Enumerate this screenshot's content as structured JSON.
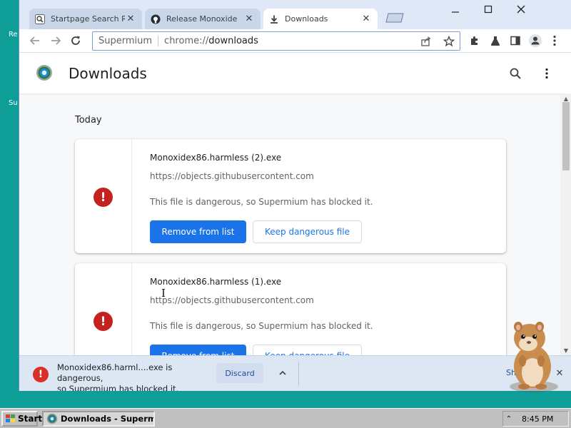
{
  "desktop": {
    "labels": [
      "Re",
      "Su"
    ]
  },
  "window": {
    "tabs": [
      {
        "title": "Startpage Search Results",
        "icon": "startpage-search-icon",
        "state": "inactive"
      },
      {
        "title": "Release Monoxide",
        "icon": "github-icon",
        "state": "inactive"
      },
      {
        "title": "Downloads",
        "icon": "download-icon",
        "state": "active"
      }
    ],
    "controls": [
      "minimize",
      "maximize",
      "close"
    ]
  },
  "toolbar": {
    "omnibox_origin": "Supermium",
    "omnibox_scheme": "chrome://",
    "omnibox_path": "downloads"
  },
  "page": {
    "title": "Downloads",
    "section": "Today",
    "items": [
      {
        "filename": "Monoxidex86.harmless (2).exe",
        "url": "https://objects.githubusercontent.com",
        "status": "This file is dangerous, so Supermium has blocked it.",
        "primary_action": "Remove from list",
        "secondary_action": "Keep dangerous file"
      },
      {
        "filename": "Monoxidex86.harmless (1).exe",
        "url": "https://objects.githubusercontent.com",
        "status": "This file is dangerous, so Supermium has blocked it.",
        "primary_action": "Remove from list",
        "secondary_action": "Keep dangerous file"
      }
    ]
  },
  "download_shelf": {
    "line1": "Monoxidex86.harml....exe is dangerous,",
    "line2": "so Supermium has blocked it.",
    "discard_label": "Discard",
    "show_all_label": "Sh"
  },
  "taskbar": {
    "start_label": "Start",
    "task_label": "Downloads - Supermi...",
    "clock": "8:45 PM"
  },
  "colors": {
    "desktop": "#0f9d97",
    "accent": "#1a73e8",
    "danger": "#c5221f",
    "tabstrip": "#dee8f6"
  }
}
